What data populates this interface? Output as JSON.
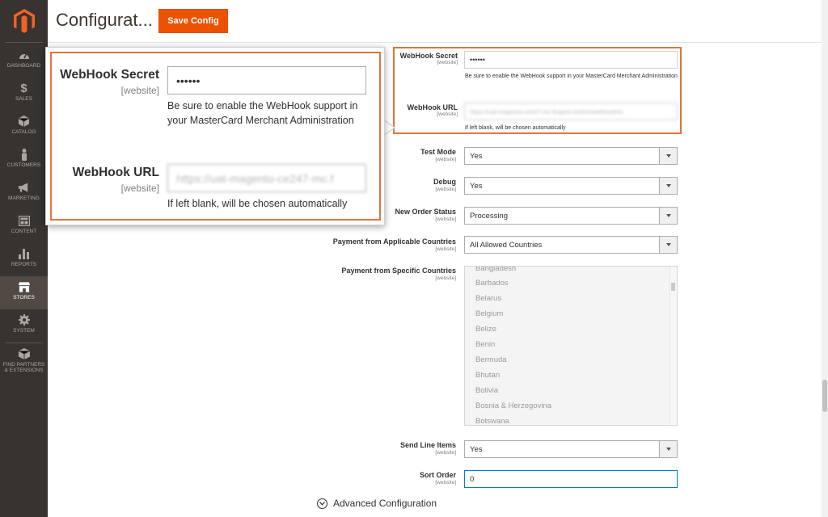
{
  "sidebar": {
    "items": [
      {
        "label": "DASHBOARD",
        "icon": "dashboard-icon"
      },
      {
        "label": "SALES",
        "icon": "dollar-icon"
      },
      {
        "label": "CATALOG",
        "icon": "box-icon"
      },
      {
        "label": "CUSTOMERS",
        "icon": "person-icon"
      },
      {
        "label": "MARKETING",
        "icon": "megaphone-icon"
      },
      {
        "label": "CONTENT",
        "icon": "layout-icon"
      },
      {
        "label": "REPORTS",
        "icon": "bar-chart-icon"
      },
      {
        "label": "STORES",
        "icon": "store-icon"
      },
      {
        "label": "SYSTEM",
        "icon": "gear-icon"
      },
      {
        "label": "FIND PARTNERS & EXTENSIONS",
        "icon": "cube-icon"
      }
    ],
    "active": "STORES"
  },
  "header": {
    "title": "Configurat...",
    "save_label": "Save Config"
  },
  "webhook": {
    "secret_label": "WebHook Secret",
    "secret_scope": "[website]",
    "secret_value": "••••••",
    "secret_note": "Be sure to enable the WebHook support in your MasterCard Merchant Administration",
    "url_label": "WebHook URL",
    "url_scope": "[website]",
    "url_value": "https://uat-magento-ce247-mc.fingent.net/tns/webhook/in",
    "url_value_zoom": "https://uat-magento-ce247-mc.f",
    "url_note": "If left blank, will be chosen automatically"
  },
  "fields": {
    "test_mode": {
      "label": "Test Mode",
      "scope": "[website]",
      "value": "Yes"
    },
    "debug": {
      "label": "Debug",
      "scope": "[website]",
      "value": "Yes"
    },
    "new_order_status": {
      "label": "New Order Status",
      "scope": "[website]",
      "value": "Processing"
    },
    "applicable_countries": {
      "label": "Payment from Applicable Countries",
      "scope": "[website]",
      "value": "All Allowed Countries"
    },
    "specific_countries": {
      "label": "Payment from Specific Countries",
      "scope": "[website]"
    },
    "send_line_items": {
      "label": "Send Line Items",
      "scope": "[website]",
      "value": "Yes"
    },
    "sort_order": {
      "label": "Sort Order",
      "scope": "[website]",
      "value": "0"
    }
  },
  "countries": [
    "Bangladesh",
    "Barbados",
    "Belarus",
    "Belgium",
    "Belize",
    "Benin",
    "Bermuda",
    "Bhutan",
    "Bolivia",
    "Bosnia & Herzegovina",
    "Botswana"
  ],
  "advanced": {
    "label": "Advanced Configuration"
  },
  "colors": {
    "accent": "#eb5202",
    "highlight": "#e0753b",
    "sidebar": "#373330"
  }
}
